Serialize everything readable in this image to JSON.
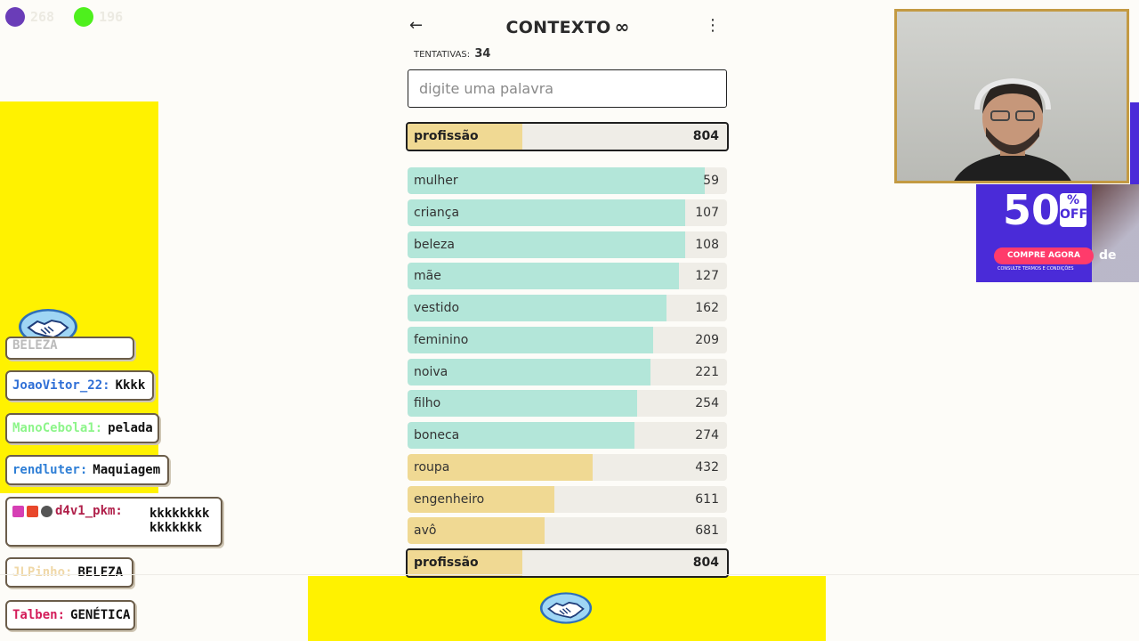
{
  "score": [
    {
      "color": "#6a3db8",
      "value": "268"
    },
    {
      "color": "#4ef01d",
      "value": "196"
    }
  ],
  "game": {
    "title": "CONTEXTO",
    "infinity_symbol": "∞",
    "back_symbol": "←",
    "menu_symbol": "⋮",
    "attempts_label": "TENTATIVAS:",
    "attempts_value": "34",
    "input_placeholder": "digite uma palavra",
    "last_guess": {
      "word": "profissão",
      "rank": "804",
      "fill_percent": 36,
      "color": "tan"
    },
    "guesses": [
      {
        "word": "mulher",
        "rank": "59",
        "fill_percent": 93,
        "color": "teal"
      },
      {
        "word": "criança",
        "rank": "107",
        "fill_percent": 87,
        "color": "teal"
      },
      {
        "word": "beleza",
        "rank": "108",
        "fill_percent": 87,
        "color": "teal"
      },
      {
        "word": "mãe",
        "rank": "127",
        "fill_percent": 85,
        "color": "teal"
      },
      {
        "word": "vestido",
        "rank": "162",
        "fill_percent": 81,
        "color": "teal"
      },
      {
        "word": "feminino",
        "rank": "209",
        "fill_percent": 77,
        "color": "teal"
      },
      {
        "word": "noiva",
        "rank": "221",
        "fill_percent": 76,
        "color": "teal"
      },
      {
        "word": "filho",
        "rank": "254",
        "fill_percent": 72,
        "color": "teal"
      },
      {
        "word": "boneca",
        "rank": "274",
        "fill_percent": 71,
        "color": "teal"
      },
      {
        "word": "roupa",
        "rank": "432",
        "fill_percent": 58,
        "color": "tan"
      },
      {
        "word": "engenheiro",
        "rank": "611",
        "fill_percent": 46,
        "color": "tan"
      },
      {
        "word": "avô",
        "rank": "681",
        "fill_percent": 43,
        "color": "tan"
      },
      {
        "word": "profissão",
        "rank": "804",
        "fill_percent": 36,
        "color": "tan",
        "highlight": true
      }
    ]
  },
  "chat": {
    "partial_msg": "BELEZA",
    "messages": [
      {
        "user": "JoaoVitor_22:",
        "user_color": "#2f6fd6",
        "text": "Kkkk"
      },
      {
        "user": "ManoCebola1:",
        "user_color": "#8df58a",
        "text": "pelada"
      },
      {
        "user": "rendluter:",
        "user_color": "#2f7fd6",
        "text": "Maquiagem"
      },
      {
        "user": "d4v1_pkm:",
        "user_color": "#b0204a",
        "text": "kkkkkkkk kkkkkkk",
        "badges": true
      },
      {
        "user": "JLPinho:",
        "user_color": "#f0d8a8",
        "text": "BELEZA"
      },
      {
        "user": "Talben:",
        "user_color": "#d41d5a",
        "text": "GENÉTICA"
      }
    ]
  },
  "ad": {
    "discount": "50",
    "percent_label": "% OFF",
    "cta": "COMPRE AGORA",
    "fineprint": "CONSULTE TERMOS E CONDIÇÕES",
    "brand": "de"
  },
  "colors": {
    "yellow": "#fff200",
    "teal_fill": "#b3e6d9",
    "tan_fill": "#f0d993",
    "webcam_border": "#c39a43"
  }
}
